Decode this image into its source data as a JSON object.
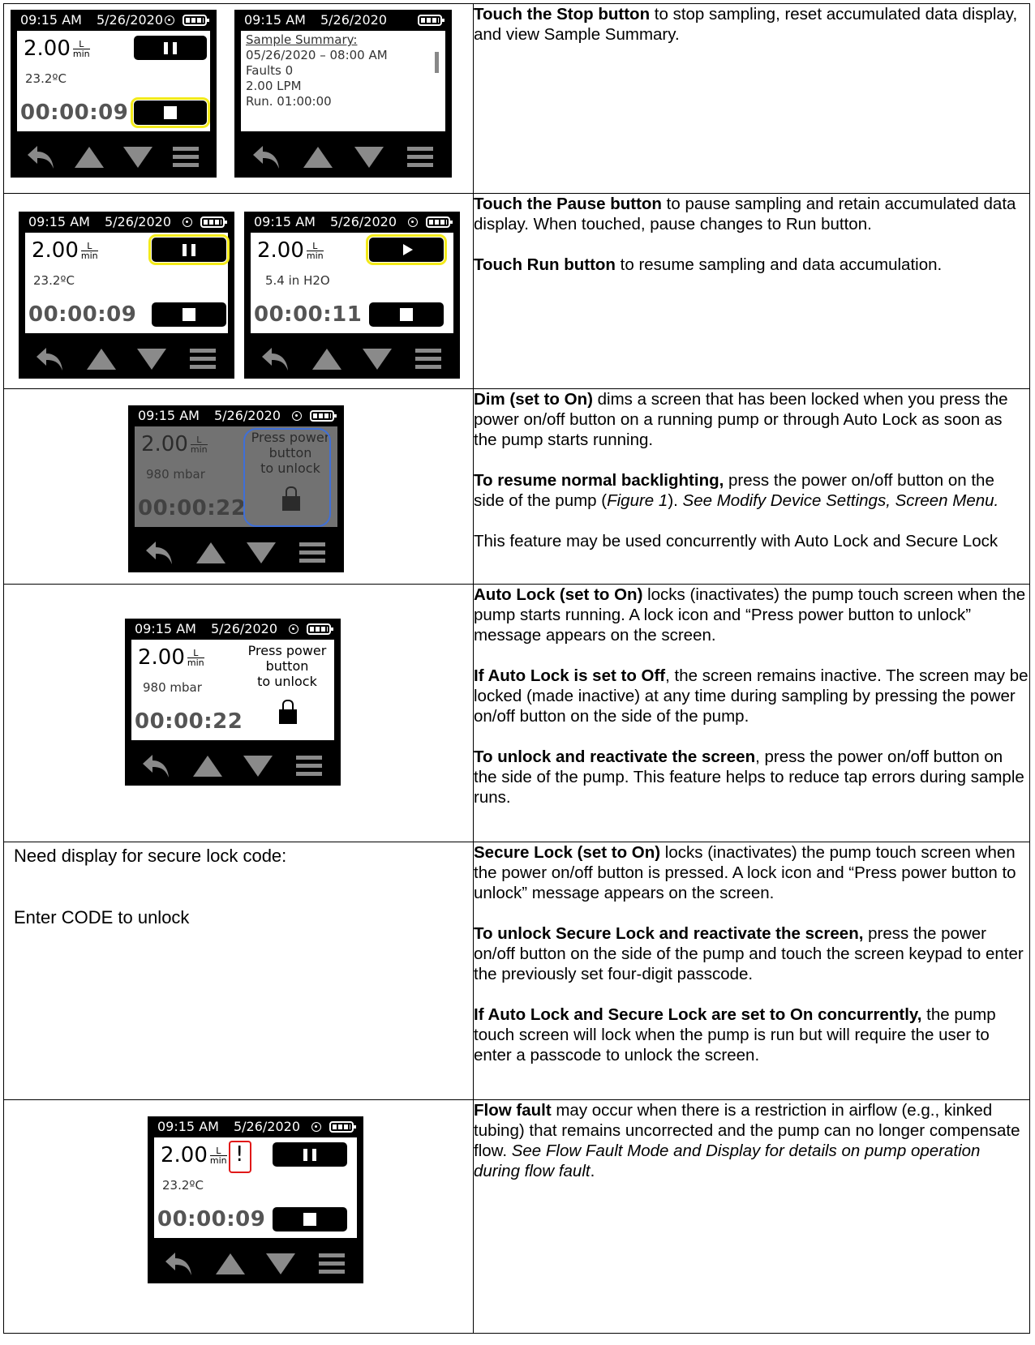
{
  "device": {
    "time": "09:15 AM",
    "date": "5/26/2020",
    "flow_value": "2.00",
    "flow_unit_top": "L",
    "flow_unit_bottom": "min",
    "temperature": "23.2ºC",
    "timer_09": "00:00:09",
    "timer_11": "00:00:11",
    "timer_22": "00:00:22",
    "pressure_h2o": "5.4 in H2O",
    "pressure_mbar": "980 mbar",
    "lock_line1": "Press power",
    "lock_line2": "button",
    "lock_line3": "to unlock",
    "fault_mark": "!"
  },
  "summary": {
    "heading": "Sample Summary:",
    "line1": "05/26/2020  –  08:00 AM",
    "line2": "Faults  0",
    "line3": "2.00 LPM",
    "line4": "Run. 01:00:00"
  },
  "rows": [
    {
      "p1_bold": "Touch the Stop button",
      "p1_rest": " to stop sampling, reset accumulated data display, and view Sample Summary."
    },
    {
      "p1_bold": "Touch the Pause button",
      "p1_rest": " to pause sampling and retain accumulated data display. When touched, pause changes to Run button.",
      "p2_bold": "Touch Run button",
      "p2_rest": " to resume sampling and data accumulation."
    },
    {
      "p1_bold": "Dim (set to On)",
      "p1_rest": " dims a screen that has been locked when you press the power on/off button on a running pump or through Auto Lock as soon as the pump starts running.",
      "p2_bold": "To resume normal backlighting,",
      "p2_rest_a": " press the power on/off button on the side of the pump (",
      "p2_figure": "Figure 1",
      "p2_rest_b": "). ",
      "p2_see": "See Modify Device Settings, Screen Menu.",
      "p3": "This feature may be used concurrently with Auto Lock and Secure Lock"
    },
    {
      "p1_bold": "Auto Lock (set to On)",
      "p1_rest": " locks (inactivates) the pump touch screen when the pump starts running. A lock icon and “Press power button to unlock” message appears on the screen.",
      "p2_bold": "If Auto Lock is set to Off",
      "p2_rest": ", the screen remains inactive. The screen may be locked (made inactive) at any time during sampling by pressing the power on/off button on the side of the pump.",
      "p3_bold": "To unlock and reactivate the screen",
      "p3_rest": ", press the power on/off button on the side of the pump. This feature helps to reduce tap errors during sample runs."
    },
    {
      "left_line1": "Need display for secure lock code:",
      "left_line2": "Enter CODE to unlock",
      "p1_bold": "Secure Lock (set to On)",
      "p1_rest": " locks (inactivates) the pump touch screen when the power on/off button is pressed. A lock icon and “Press power button to unlock” message appears on the screen.",
      "p2_bold": "To unlock Secure Lock and reactivate the screen,",
      "p2_rest": " press the power on/off button on the side of the pump and touch the screen keypad to enter the previously set four-digit passcode.",
      "p3_bold": "If Auto Lock and Secure Lock are set to On concurrently,",
      "p3_rest": " the pump touch screen will lock when the pump is run but will require the user to enter a passcode to unlock the screen."
    },
    {
      "p1_bold": "Flow fault",
      "p1_rest": " may occur when there is a restriction in airflow (e.g., kinked tubing) that remains uncorrected and the pump can no longer compensate flow. ",
      "p1_italic": "See Flow Fault Mode and Display for details on pump operation during flow fault",
      "p1_end": "."
    }
  ]
}
